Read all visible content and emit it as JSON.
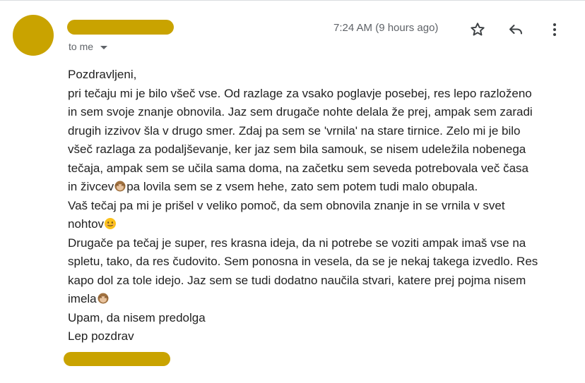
{
  "email": {
    "recipient_label": "to me",
    "timestamp": "7:24 AM (9 hours ago)",
    "lines": [
      [
        "Pozdravljeni,"
      ],
      [
        "pri tečaju mi je bilo všeč vse. Od razlage za vsako poglavje posebej, res lepo razloženo"
      ],
      [
        "in sem svoje znanje obnovila. Jaz sem drugače nohte delala že prej, ampak sem zaradi"
      ],
      [
        "drugih izzivov šla v drugo smer. Zdaj pa sem se 'vrnila' na stare tirnice. Zelo mi je bilo"
      ],
      [
        "všeč razlaga za podaljševanje, ker jaz sem bila samouk, se nisem udeležila nobenega"
      ],
      [
        "tečaja, ampak sem se učila sama doma, na začetku sem seveda potrebovala več časa"
      ],
      [
        "in živcev",
        "pa lovila sem se z vsem hehe, zato sem potem tudi malo obupala."
      ],
      [
        "Vaš tečaj pa mi je prišel v veliko pomoč, da sem obnovila znanje in se vrnila v svet"
      ],
      [
        "nohtov"
      ],
      [
        "Drugače pa tečaj je super, res krasna ideja, da ni potrebe se voziti ampak imaš vse na"
      ],
      [
        "spletu, tako, da res čudovito. Sem ponosna in vesela, da se je nekaj takega izvedlo. Res"
      ],
      [
        "kapo dol za tole idejo. Jaz sem se tudi dodatno naučila stvari, katere prej pojma nisem"
      ],
      [
        "imela"
      ],
      [
        "Upam, da nisem predolga"
      ],
      [
        "Lep pozdrav"
      ]
    ]
  },
  "icons": {
    "star": "star-icon",
    "reply": "reply-icon",
    "more": "more-vert-icon",
    "monkey": "see-no-evil-monkey-emoji",
    "smile": "smiling-face-emoji"
  },
  "colors": {
    "redaction": "#c9a300",
    "text": "#222222",
    "muted": "#5f6368"
  }
}
